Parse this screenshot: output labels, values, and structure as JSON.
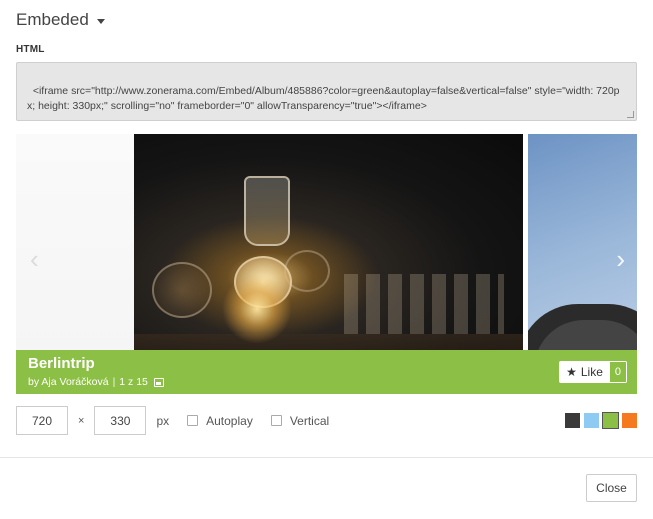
{
  "header": {
    "title": "Embeded"
  },
  "html_label": "HTML",
  "embed_code": "<iframe src=\"http://www.zonerama.com/Embed/Album/485886?color=green&autoplay=false&vertical=false\" style=\"width: 720px; height: 330px;\" scrolling=\"no\" frameborder=\"0\" allowTransparency=\"true\"></iframe>",
  "gallery": {
    "album_title": "Berlintrip",
    "author": "by Aja Voráčková",
    "separator": "|",
    "counter": "1 z 15",
    "like_label": "Like",
    "like_count": "0",
    "prev_arrow": "‹",
    "next_arrow": "›"
  },
  "controls": {
    "width": "720",
    "times": "×",
    "height": "330",
    "unit": "px",
    "autoplay_label": "Autoplay",
    "autoplay_checked": false,
    "vertical_label": "Vertical",
    "vertical_checked": false,
    "colors": [
      {
        "name": "dark",
        "hex": "#3a3a3a"
      },
      {
        "name": "blue",
        "hex": "#8ecaf2"
      },
      {
        "name": "green",
        "hex": "#8cbf45",
        "selected": true
      },
      {
        "name": "orange",
        "hex": "#f57a1f"
      }
    ]
  },
  "footer": {
    "close_label": "Close"
  },
  "icons": {
    "caret": "caret-down-icon",
    "star": "star-icon",
    "photos": "photos-icon",
    "prev": "chevron-left-icon",
    "next": "chevron-right-icon"
  }
}
